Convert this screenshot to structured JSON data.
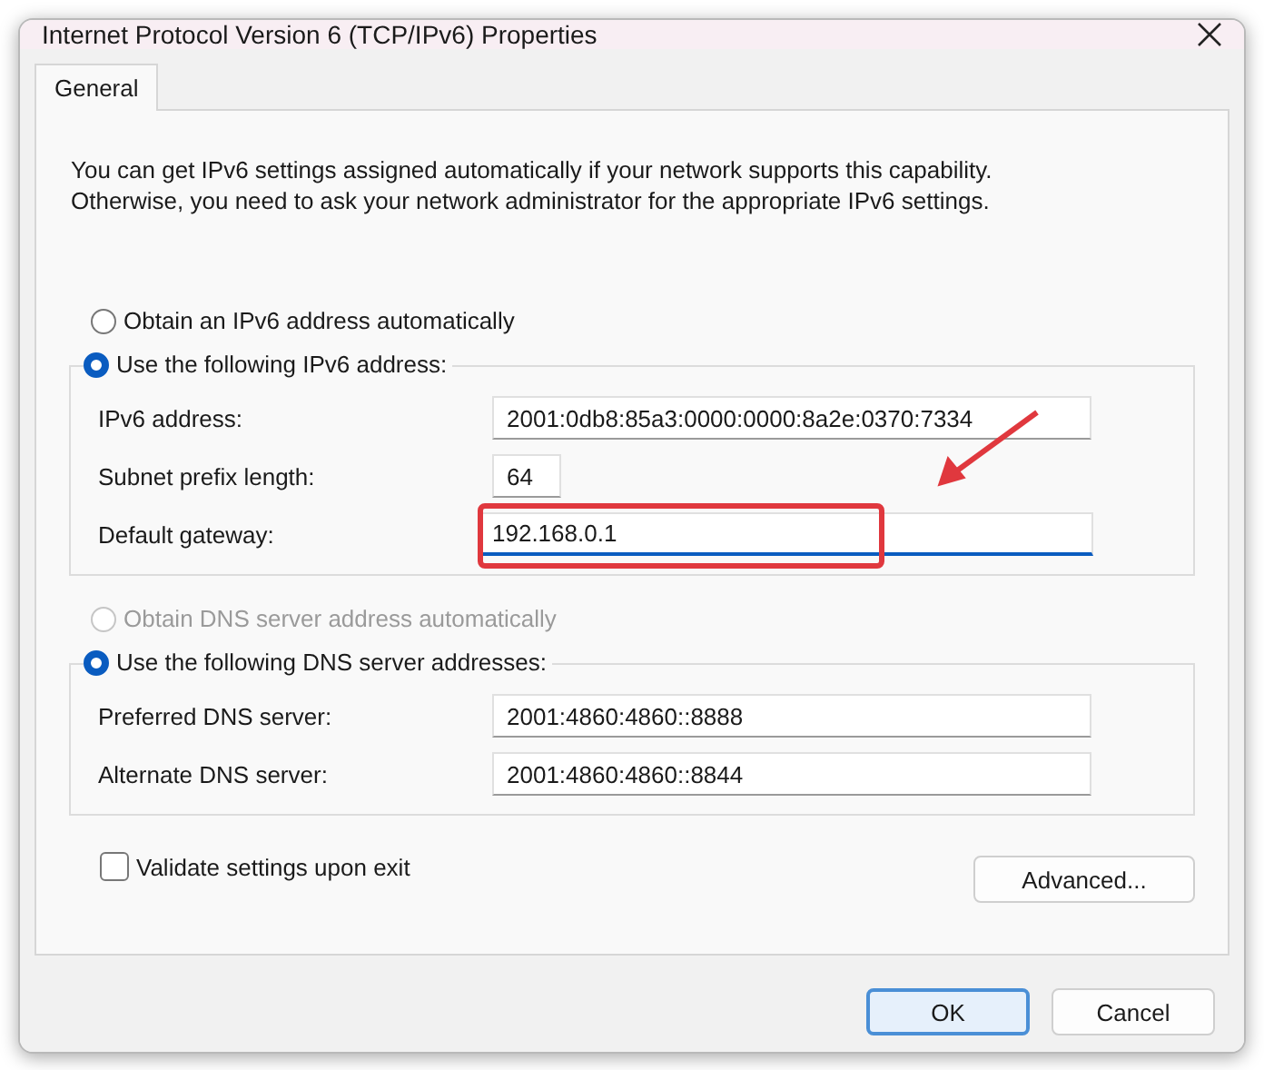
{
  "window": {
    "title": "Internet Protocol Version 6 (TCP/IPv6) Properties"
  },
  "tabs": [
    {
      "label": "General",
      "selected": true
    }
  ],
  "description_lines": [
    "You can get IPv6 settings assigned automatically if your network supports this capability.",
    "Otherwise, you need to ask your network administrator for the appropriate IPv6 settings."
  ],
  "sections": [
    {
      "auto_option": {
        "label": "Obtain an IPv6 address automatically",
        "selected": false,
        "disabled": false
      },
      "manual_option": {
        "label": "Use the following IPv6 address:",
        "selected": true
      },
      "fields": [
        {
          "label": "IPv6 address:",
          "value": "2001:0db8:85a3:0000:0000:8a2e:0370:7334",
          "kind": "wide",
          "focused": false,
          "highlighted": false
        },
        {
          "label": "Subnet prefix length:",
          "value": "64",
          "kind": "short",
          "focused": false,
          "highlighted": false
        },
        {
          "label": "Default gateway:",
          "value": "192.168.0.1",
          "kind": "wide",
          "focused": true,
          "highlighted": true
        }
      ]
    },
    {
      "auto_option": {
        "label": "Obtain DNS server address automatically",
        "selected": false,
        "disabled": true
      },
      "manual_option": {
        "label": "Use the following DNS server addresses:",
        "selected": true
      },
      "fields": [
        {
          "label": "Preferred DNS server:",
          "value": "2001:4860:4860::8888",
          "kind": "wide",
          "focused": false,
          "highlighted": false
        },
        {
          "label": "Alternate DNS server:",
          "value": "2001:4860:4860::8844",
          "kind": "wide",
          "focused": false,
          "highlighted": false
        }
      ]
    }
  ],
  "validate": {
    "label": "Validate settings upon exit",
    "checked": false
  },
  "advanced_button": "Advanced...",
  "buttons": [
    {
      "label": "OK",
      "kind": "default"
    },
    {
      "label": "Cancel",
      "kind": "normal"
    }
  ]
}
